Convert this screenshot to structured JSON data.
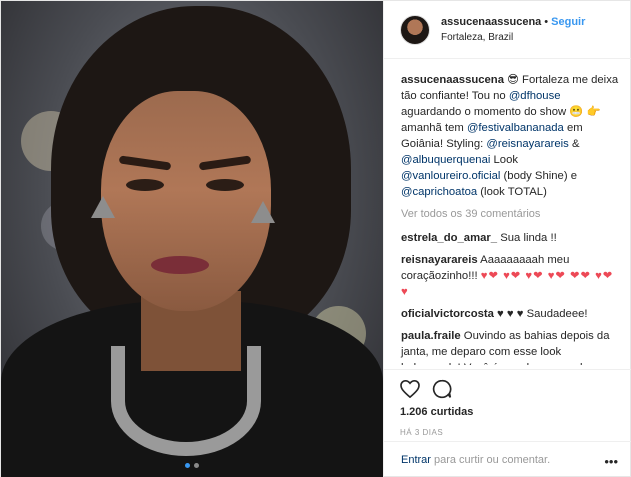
{
  "header": {
    "username": "assucenaassucena",
    "separator": "•",
    "follow_label": "Seguir",
    "location": "Fortaleza, Brazil"
  },
  "caption": {
    "username": "assucenaassucena",
    "parts": {
      "p1": " Fortaleza me deixa tão confiante! Tou no ",
      "m1": "@dfhouse",
      "p2": " aguardando o momento do show ",
      "p3": " amanhã tem ",
      "m2": "@festivalbananada",
      "p4": " em Goiânia! Styling: ",
      "m3": "@reisnayarareis",
      "p5": " & ",
      "m4": "@albuquerquenai",
      "p6": " Look ",
      "m5": "@vanloureiro.oficial",
      "p7": " (body Shine) e ",
      "m6": "@caprichoatoa",
      "p8": " (look TOTAL)"
    }
  },
  "view_all_comments": "Ver todos os 39 comentários",
  "comments": [
    {
      "user": "estrela_do_amar_",
      "text": " Sua linda !!"
    },
    {
      "user": "reisnayarareis",
      "text": " Aaaaaaaaah meu coraçãozinho!!! ",
      "hearts": "♥❤ ♥❤ ♥❤ ♥❤ ❤❤ ♥❤ ♥"
    },
    {
      "user": "oficialvictorcosta",
      "bhearts": " ♥ ♥ ♥ ",
      "text": "Saudadeee!"
    },
    {
      "user": "paula.fraile",
      "text": " Ouvindo as bahias depois da janta, me deparo com esse look babaaaado! Você é um abraço na alma, Assucena!"
    }
  ],
  "likes": "1.206 curtidas",
  "time": "HÁ 3 DIAS",
  "add_comment": {
    "login_label": "Entrar",
    "text": "para curtir ou comentar."
  },
  "icons": [
    "heart-icon",
    "comment-icon",
    "more-icon"
  ],
  "colors": {
    "link": "#3897f0",
    "mention": "#003569",
    "heart": "#ed4956"
  },
  "carousel": {
    "count": 2,
    "active": 0
  }
}
